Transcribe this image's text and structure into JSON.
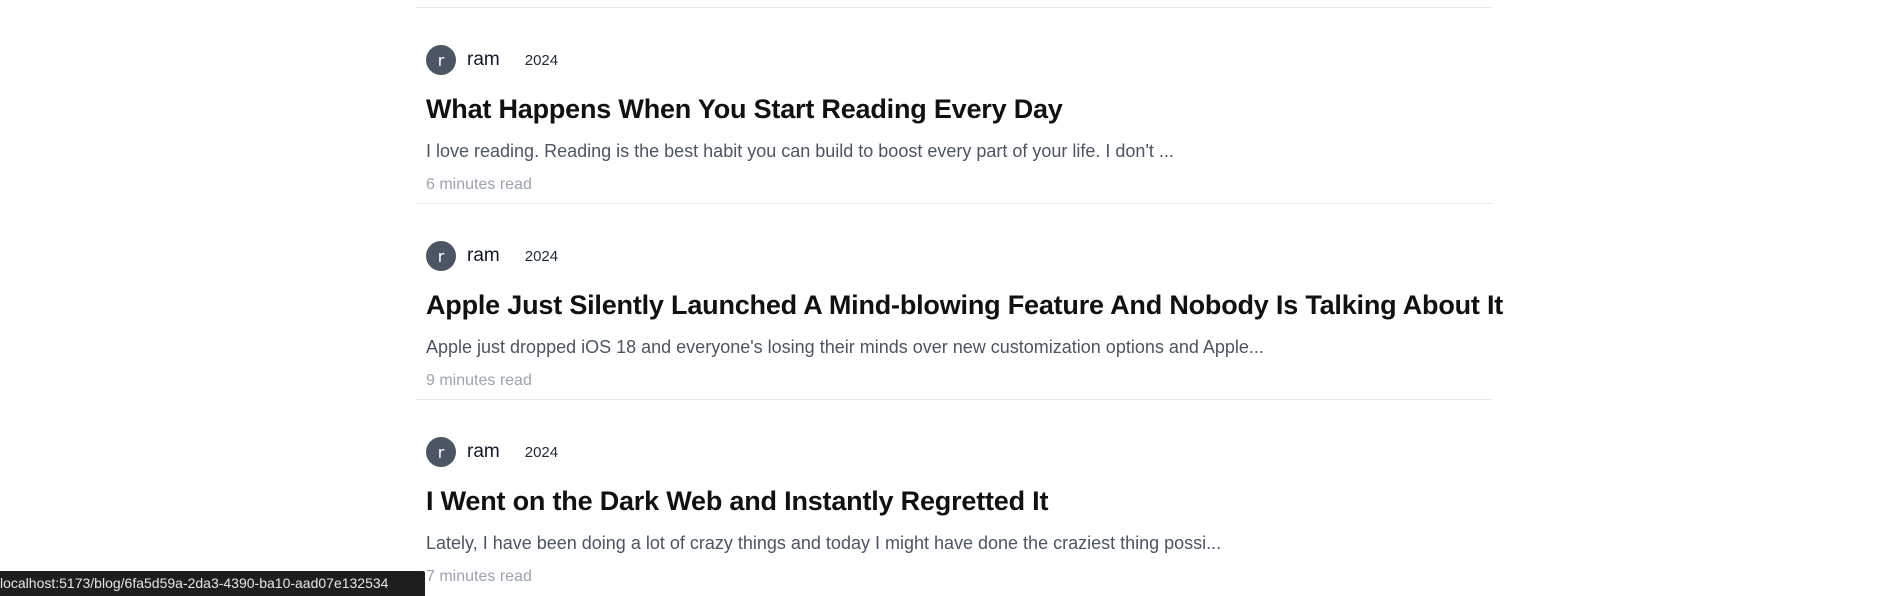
{
  "posts": [
    {
      "avatar_initial": "r",
      "author": "ram",
      "year": "2024",
      "title": "What Happens When You Start Reading Every Day",
      "excerpt": "I love reading. Reading is the best habit you can build to boost every part of your life. I don't ...",
      "read_time": "6 minutes read"
    },
    {
      "avatar_initial": "r",
      "author": "ram",
      "year": "2024",
      "title": "Apple Just Silently Launched A Mind-blowing Feature And Nobody Is Talking About It",
      "excerpt": "Apple just dropped iOS 18 and everyone's losing their minds over new customization options and Apple...",
      "read_time": "9 minutes read"
    },
    {
      "avatar_initial": "r",
      "author": "ram",
      "year": "2024",
      "title": "I Went on the Dark Web and Instantly Regretted It",
      "excerpt": "Lately, I have been doing a lot of crazy things and today I might have done the craziest thing possi...",
      "read_time": "7 minutes read"
    }
  ],
  "status_bar": {
    "url": "localhost:5173/blog/6fa5d59a-2da3-4390-ba10-aad07e132534"
  }
}
